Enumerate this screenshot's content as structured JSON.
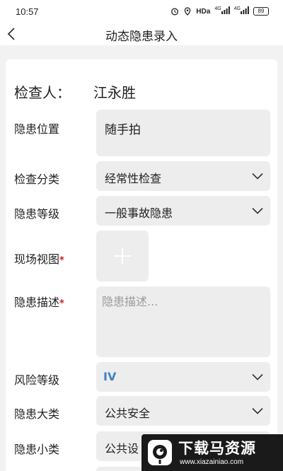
{
  "status_bar": {
    "time": "10:57",
    "network": "HDa",
    "signal_1": "4G",
    "signal_2": "4G",
    "battery": "89"
  },
  "nav": {
    "title": "动态隐患录入"
  },
  "form": {
    "inspector_label": "检查人：",
    "inspector_name": "江永胜",
    "location": {
      "label": "隐患位置",
      "value": "随手拍"
    },
    "check_type": {
      "label": "检查分类",
      "value": "经常性检查"
    },
    "hazard_level": {
      "label": "隐患等级",
      "value": "一般事故隐患"
    },
    "site_photo": {
      "label": "现场视图",
      "required_mark": "*"
    },
    "description": {
      "label": "隐患描述",
      "required_mark": "*",
      "placeholder": "隐患描述..."
    },
    "risk_level": {
      "label": "风险等级",
      "value": "IV"
    },
    "hazard_category": {
      "label": "隐患大类",
      "value": "公共安全"
    },
    "hazard_subcategory": {
      "label": "隐患小类",
      "value": "公共设"
    }
  },
  "watermark": {
    "title": "下载马资源",
    "url": "www.xiazainiao.com"
  },
  "colors": {
    "background": "#f2f2f2",
    "card": "#ffffff",
    "field": "#ededed",
    "required": "#c8201a",
    "risk_value": "#3b82c4"
  }
}
